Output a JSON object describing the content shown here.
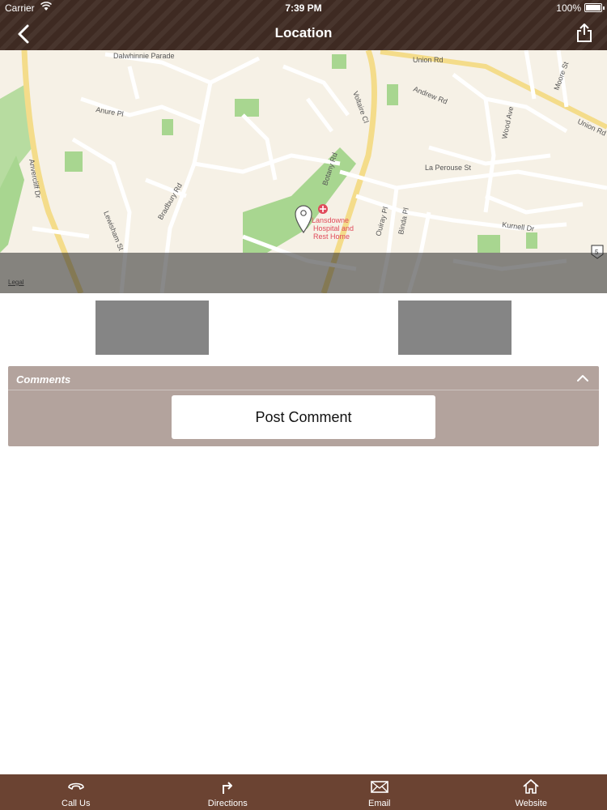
{
  "status_bar": {
    "carrier": "Carrier",
    "time": "7:39 PM",
    "battery": "100%"
  },
  "nav": {
    "title": "Location",
    "back_icon": "chevron-left-icon",
    "share_icon": "share-icon"
  },
  "map": {
    "legal": "Legal",
    "labels": {
      "dalwhinnie": "Dalwhinnie Parade",
      "union_rd_top": "Union Rd",
      "andrew_rd": "Andrew Rd",
      "moore_st": "Moore St",
      "union_rd_right": "Union Rd",
      "anure_pl": "Anure Pl",
      "voltaire_cl": "Voltaire Cl",
      "wood_ave": "Wood Ave",
      "la_perouse": "La Perouse St",
      "botany_rd": "Botany Rd",
      "bradbury_rd": "Bradbury Rd",
      "lansdowne": "Lansdowne",
      "hospital_and": "Hospital and",
      "rest_home": "Rest Home",
      "ouiray_pl": "Ouiray Pl",
      "binda_pl": "Binda Pl",
      "kurnell_dr": "Kurnell Dr",
      "lewisham_st": "Lewisham St",
      "alvercliff_dr": "Anvercliff Dr",
      "route_5": "5"
    }
  },
  "comments": {
    "title": "Comments",
    "post_label": "Post Comment",
    "collapse_icon": "chevron-up-icon"
  },
  "tabbar": {
    "items": [
      {
        "label": "Call Us",
        "icon": "phone-icon"
      },
      {
        "label": "Directions",
        "icon": "directions-arrow-icon"
      },
      {
        "label": "Email",
        "icon": "envelope-icon"
      },
      {
        "label": "Website",
        "icon": "home-icon"
      }
    ]
  },
  "colors": {
    "header": "#3e2a22",
    "tabbar": "#6b4332",
    "comments_panel": "#b3a39d",
    "gray_block": "#858585"
  }
}
